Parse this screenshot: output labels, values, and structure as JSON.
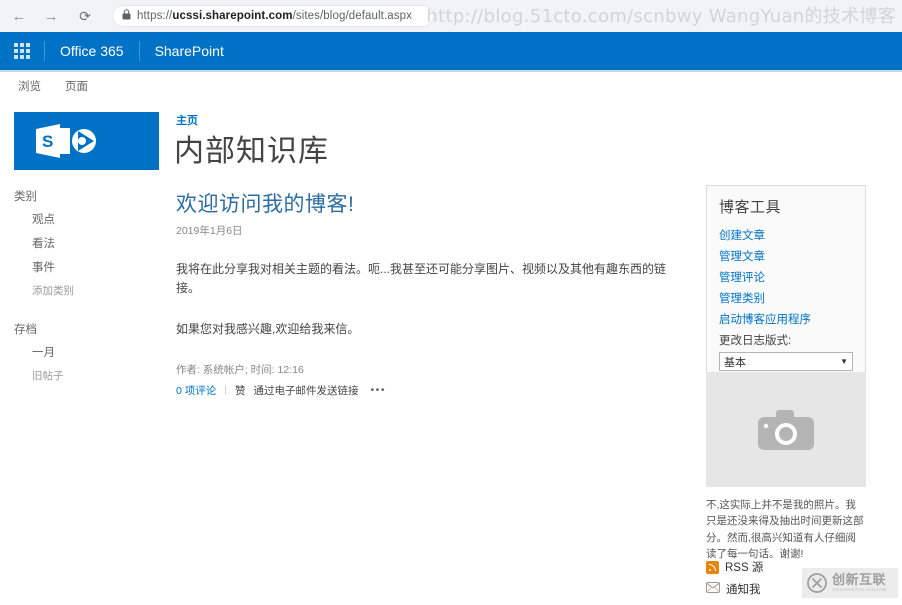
{
  "browser": {
    "back_icon": "arrow-left-icon",
    "forward_icon": "arrow-right-icon",
    "reload_icon": "reload-icon",
    "lock_icon": "lock-icon",
    "url_prefix": "https://",
    "url_domain": "ucssi.sharepoint.com",
    "url_path": "/sites/blog/default.aspx",
    "url_full": "https://ucssi.sharepoint.com/sites/blog/default.aspx"
  },
  "watermark": {
    "top_text": "http://blog.51cto.com/scnbwy WangYuan的技术博客",
    "logo_main": "创新互联",
    "logo_sub": "CHUANGXIN HULIAN"
  },
  "suite_bar": {
    "waffle_icon": "app-launcher-icon",
    "office_label": "Office 365",
    "sharepoint_label": "SharePoint",
    "background_color": "#0072c6"
  },
  "ribbon": {
    "tabs": [
      {
        "label": "浏览"
      },
      {
        "label": "页面"
      }
    ]
  },
  "site_header": {
    "logo_icon": "sharepoint-logo-icon",
    "breadcrumb": "主页",
    "title": "内部知识库"
  },
  "left_nav": {
    "categories_heading": "类别",
    "categories": [
      {
        "label": "观点"
      },
      {
        "label": "看法"
      },
      {
        "label": "事件"
      }
    ],
    "add_category": "添加类别",
    "archive_heading": "存档",
    "archive_items": [
      {
        "label": "一月"
      }
    ],
    "older_posts": "旧帖子"
  },
  "post": {
    "title": "欢迎访问我的博客!",
    "date": "2019年1月6日",
    "paragraphs": [
      "我将在此分享我对相关主题的看法。呃...我甚至还可能分享图片、视频以及其他有趣东西的链接。",
      "如果您对我感兴趣,欢迎给我来信。"
    ],
    "meta": "作者: 系统帐户; 时间: 12:16",
    "comments_link": "0 项评论",
    "separator": "|",
    "like_label": "赞",
    "email_link_label": "通过电子邮件发送链接",
    "more_icon": "•••"
  },
  "blog_tools": {
    "title": "博客工具",
    "links": [
      {
        "label": "创建文章"
      },
      {
        "label": "管理文章"
      },
      {
        "label": "管理评论"
      },
      {
        "label": "管理类别"
      },
      {
        "label": "启动博客应用程序"
      }
    ],
    "layout_label": "更改日志版式:",
    "layout_selected": "基本",
    "caret_icon": "chevron-down-icon",
    "link_color": "#0072c6"
  },
  "photo_webpart": {
    "placeholder_icon": "camera-icon",
    "caption": "不,这实际上并不是我的照片。我只是还没来得及抽出时间更新这部分。然而,很高兴知道有人仔细阅读了每一句话。谢谢!"
  },
  "feeds": {
    "rss_icon": "rss-icon",
    "rss_label": "RSS 源",
    "alert_icon": "mail-alert-icon",
    "alert_label": "通知我",
    "rss_color": "#e8840c"
  }
}
